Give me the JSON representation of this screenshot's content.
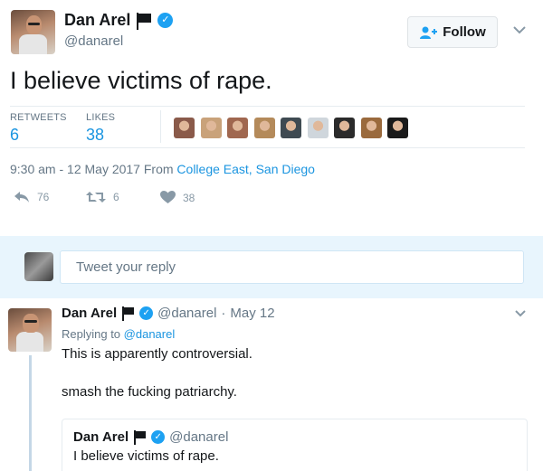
{
  "tweet": {
    "author_name": "Dan Arel",
    "author_handle": "@danarel",
    "follow_label": "Follow",
    "text": "I believe victims of rape.",
    "retweets_label": "RETWEETS",
    "retweets_count": "6",
    "likes_label": "LIKES",
    "likes_count": "38",
    "time": "9:30 am - 12 May 2017 From ",
    "location": "College East, San Diego",
    "actions": {
      "reply_count": "76",
      "retweet_count": "6",
      "like_count": "38"
    },
    "liker_colors": [
      "#8a5a4a",
      "#c9a27a",
      "#a0674f",
      "#b48a5a",
      "#3f4a52",
      "#cfd6dc",
      "#2b2b2b",
      "#9a6a3d",
      "#1a1a1a"
    ]
  },
  "reply_box": {
    "placeholder": "Tweet your reply"
  },
  "reply": {
    "author_name": "Dan Arel",
    "author_handle": "@danarel",
    "separator": "·",
    "date": "May 12",
    "replying_to_label": "Replying to",
    "replying_to_handle": "@danarel",
    "line1": "This is apparently controversial.",
    "line2": "smash the fucking patriarchy.",
    "quote": {
      "author_name": "Dan Arel",
      "author_handle": "@danarel",
      "text": "I believe victims of rape."
    }
  },
  "colors": {
    "accent": "#1da1f2",
    "link": "#1b95e0",
    "reply_bar": "#e8f5fd"
  }
}
